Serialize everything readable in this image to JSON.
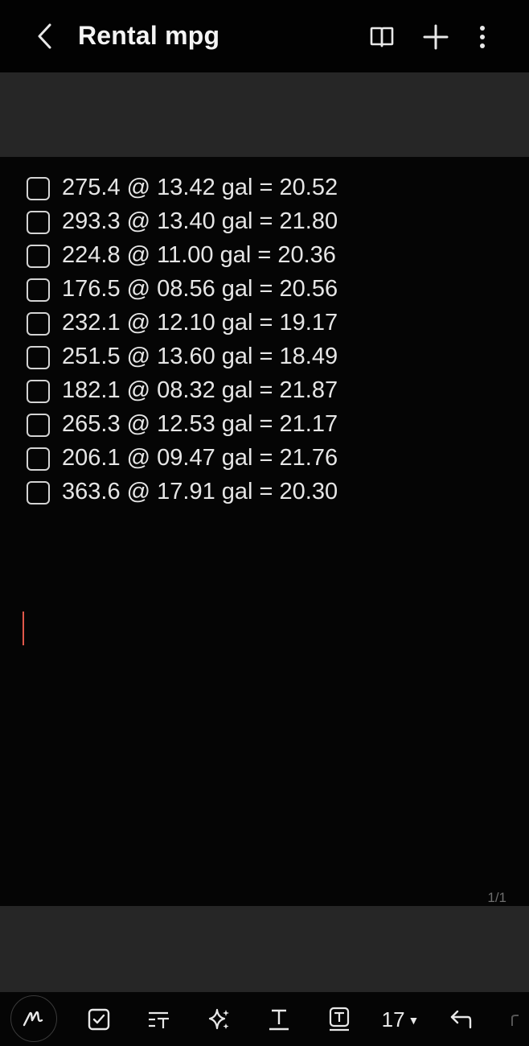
{
  "header": {
    "title": "Rental mpg",
    "back_icon": "chevron-left-icon",
    "icons": [
      "book-open-icon",
      "plus-icon",
      "more-vertical-icon"
    ]
  },
  "checklist": [
    {
      "text": "275.4 @ 13.42 gal = 20.52",
      "checked": false
    },
    {
      "text": "293.3 @ 13.40 gal = 21.80",
      "checked": false
    },
    {
      "text": "224.8 @ 11.00 gal = 20.36",
      "checked": false
    },
    {
      "text": "176.5 @ 08.56 gal = 20.56",
      "checked": false
    },
    {
      "text": "232.1 @ 12.10 gal = 19.17",
      "checked": false
    },
    {
      "text": "251.5 @ 13.60 gal = 18.49",
      "checked": false
    },
    {
      "text": "182.1 @ 08.32 gal = 21.87",
      "checked": false
    },
    {
      "text": "265.3 @ 12.53 gal = 21.17",
      "checked": false
    },
    {
      "text": "206.1 @ 09.47 gal = 21.76",
      "checked": false
    },
    {
      "text": "363.6 @ 17.91 gal = 20.30",
      "checked": false
    }
  ],
  "page_indicator": "1/1",
  "toolbar": {
    "font_size": "17",
    "icons": [
      "handwriting-pen-icon",
      "checklist-icon",
      "paragraph-style-icon",
      "ai-sparkle-icon",
      "text-format-icon",
      "text-box-icon",
      "font-size-dropdown",
      "undo-icon"
    ]
  },
  "colors": {
    "background": "#050505",
    "band": "#262626",
    "cursor": "#e0584a",
    "text": "#e6e6e6"
  }
}
